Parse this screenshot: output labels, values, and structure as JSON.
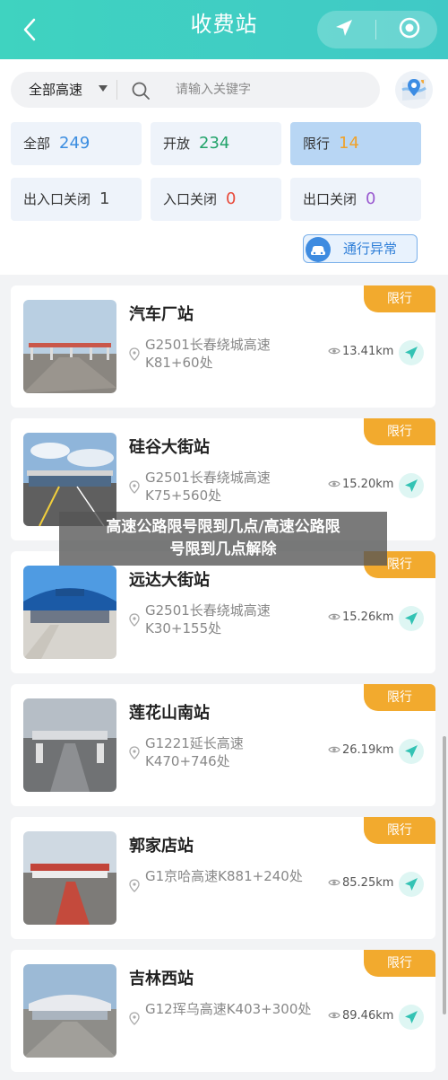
{
  "header": {
    "title": "收费站",
    "back_icon": "chevron-left-icon"
  },
  "search": {
    "filter_value": "全部高速",
    "placeholder": "请输入关键字"
  },
  "status_filters": [
    {
      "label": "全部",
      "count": "249",
      "color": "#3b8de0"
    },
    {
      "label": "开放",
      "count": "234",
      "color": "#22a36a"
    },
    {
      "label": "限行",
      "count": "14",
      "color": "#f0a22a"
    },
    {
      "label": "出入口关闭",
      "count": "1",
      "color": "#444444"
    },
    {
      "label": "入口关闭",
      "count": "0",
      "color": "#e84a3a"
    },
    {
      "label": "出口关闭",
      "count": "0",
      "color": "#9a5ad0"
    }
  ],
  "abnormal_button": {
    "label": "通行异常"
  },
  "stations": [
    {
      "name": "汽车厂站",
      "address": "G2501长春绕城高速K81+60处",
      "distance": "13.41km",
      "tag": "限行"
    },
    {
      "name": "硅谷大街站",
      "address": "G2501长春绕城高速K75+560处",
      "distance": "15.20km",
      "tag": "限行"
    },
    {
      "name": "远达大街站",
      "address": "G2501长春绕城高速K30+155处",
      "distance": "15.26km",
      "tag": "限行"
    },
    {
      "name": "莲花山南站",
      "address": "G1221延长高速K470+746处",
      "distance": "26.19km",
      "tag": "限行"
    },
    {
      "name": "郭家店站",
      "address": "G1京哈高速K881+240处",
      "distance": "85.25km",
      "tag": "限行"
    },
    {
      "name": "吉林西站",
      "address": "G12珲乌高速K403+300处",
      "distance": "89.46km",
      "tag": "限行"
    }
  ],
  "overlay": {
    "line1": "高速公路限号限到几点/高速公路限",
    "line2": "号限到几点解除"
  },
  "colors": {
    "brand": "#40cfc2",
    "tag": "#f2aa2e",
    "nav": "#33c3b4"
  }
}
